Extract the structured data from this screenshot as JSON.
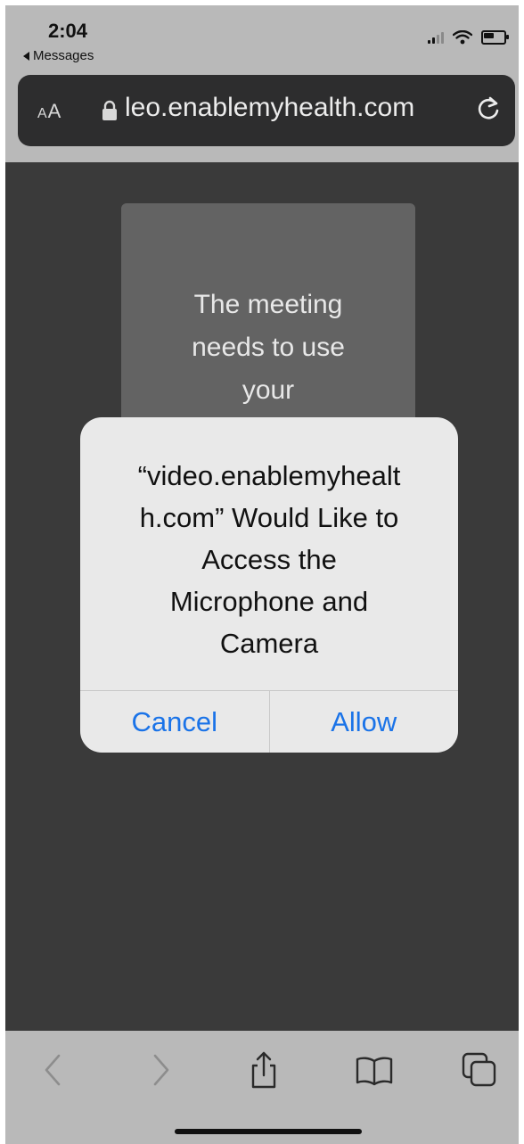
{
  "status_bar": {
    "time": "2:04",
    "back_app": "Messages"
  },
  "url_bar": {
    "text_size_label": "AA",
    "url": "leo.enablemyhealth.com"
  },
  "page_card": {
    "lines": [
      "The meeting",
      "needs to use",
      "your"
    ]
  },
  "alert": {
    "message_lines": [
      "“video.enablemyhealt",
      "h.com” Would Like to",
      "Access the",
      "Microphone and",
      "Camera"
    ],
    "cancel_label": "Cancel",
    "allow_label": "Allow"
  },
  "toolbar": {
    "icons": [
      "back-icon",
      "forward-icon",
      "share-icon",
      "bookmarks-icon",
      "tabs-icon"
    ]
  },
  "colors": {
    "accent": "#1a73e8",
    "chrome": "#b9b9b9",
    "page_bg": "#3a3a3a"
  }
}
